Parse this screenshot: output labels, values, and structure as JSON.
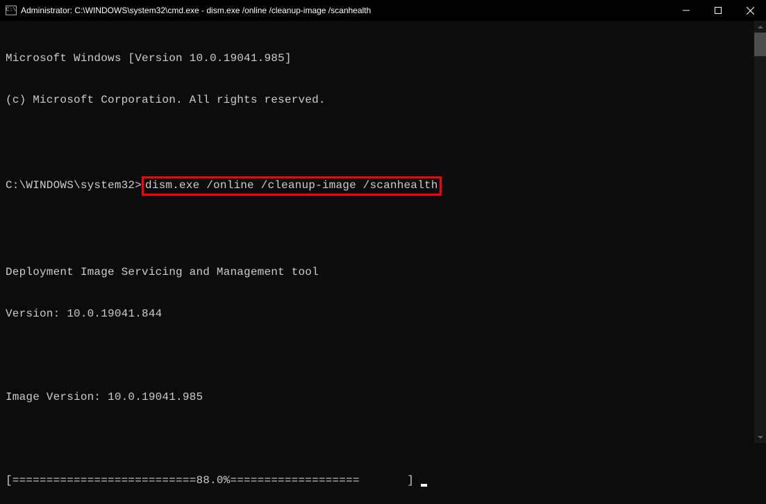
{
  "titlebar": {
    "icon_text": "C:\\",
    "title": "Administrator: C:\\WINDOWS\\system32\\cmd.exe - dism.exe  /online /cleanup-image /scanhealth"
  },
  "terminal": {
    "line1": "Microsoft Windows [Version 10.0.19041.985]",
    "line2": "(c) Microsoft Corporation. All rights reserved.",
    "prompt": "C:\\WINDOWS\\system32>",
    "command": "dism.exe /online /cleanup-image /scanhealth",
    "tool_line": "Deployment Image Servicing and Management tool",
    "version_line": "Version: 10.0.19041.844",
    "image_version_line": "Image Version: 10.0.19041.985",
    "progress_line": "[===========================88.0%===================       ] "
  }
}
